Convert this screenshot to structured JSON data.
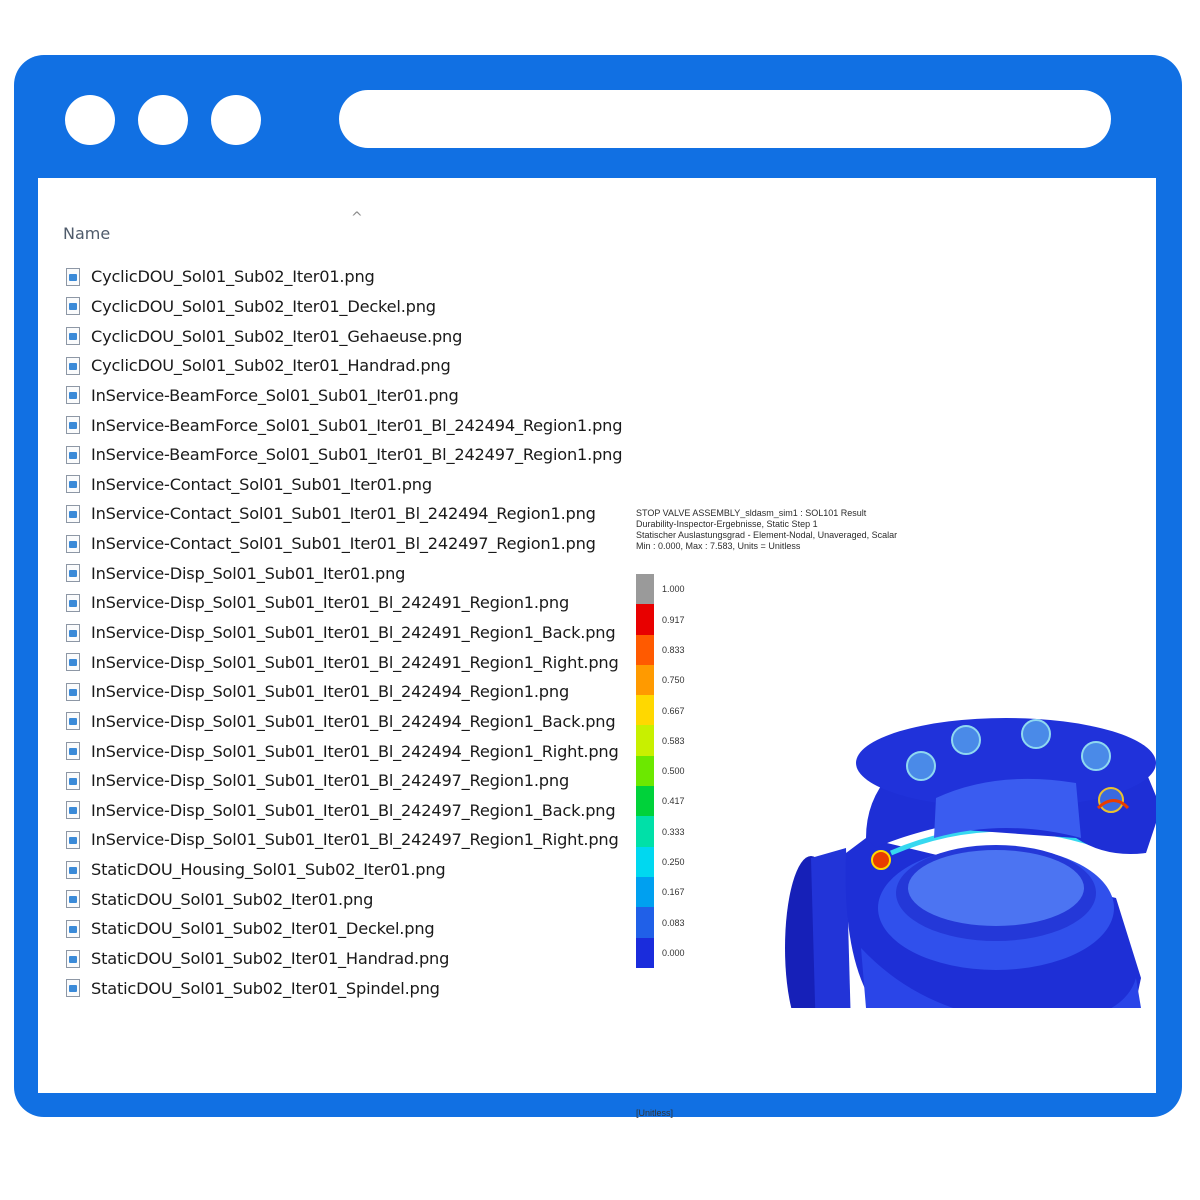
{
  "window": {
    "frame_color": "#1170e3",
    "controls": [
      "window-dot-1",
      "window-dot-2",
      "window-dot-3"
    ],
    "address": ""
  },
  "explorer": {
    "column_header": "Name",
    "sort_indicator": "^",
    "files": [
      "CyclicDOU_Sol01_Sub02_Iter01.png",
      "CyclicDOU_Sol01_Sub02_Iter01_Deckel.png",
      "CyclicDOU_Sol01_Sub02_Iter01_Gehaeuse.png",
      "CyclicDOU_Sol01_Sub02_Iter01_Handrad.png",
      "InService-BeamForce_Sol01_Sub01_Iter01.png",
      "InService-BeamForce_Sol01_Sub01_Iter01_Bl_242494_Region1.png",
      "InService-BeamForce_Sol01_Sub01_Iter01_Bl_242497_Region1.png",
      "InService-Contact_Sol01_Sub01_Iter01.png",
      "InService-Contact_Sol01_Sub01_Iter01_Bl_242494_Region1.png",
      "InService-Contact_Sol01_Sub01_Iter01_Bl_242497_Region1.png",
      "InService-Disp_Sol01_Sub01_Iter01.png",
      "InService-Disp_Sol01_Sub01_Iter01_Bl_242491_Region1.png",
      "InService-Disp_Sol01_Sub01_Iter01_Bl_242491_Region1_Back.png",
      "InService-Disp_Sol01_Sub01_Iter01_Bl_242491_Region1_Right.png",
      "InService-Disp_Sol01_Sub01_Iter01_Bl_242494_Region1.png",
      "InService-Disp_Sol01_Sub01_Iter01_Bl_242494_Region1_Back.png",
      "InService-Disp_Sol01_Sub01_Iter01_Bl_242494_Region1_Right.png",
      "InService-Disp_Sol01_Sub01_Iter01_Bl_242497_Region1.png",
      "InService-Disp_Sol01_Sub01_Iter01_Bl_242497_Region1_Back.png",
      "InService-Disp_Sol01_Sub01_Iter01_Bl_242497_Region1_Right.png",
      "StaticDOU_Housing_Sol01_Sub02_Iter01.png",
      "StaticDOU_Sol01_Sub02_Iter01.png",
      "StaticDOU_Sol01_Sub02_Iter01_Deckel.png",
      "StaticDOU_Sol01_Sub02_Iter01_Handrad.png",
      "StaticDOU_Sol01_Sub02_Iter01_Spindel.png"
    ]
  },
  "result_preview": {
    "header_lines": [
      "STOP VALVE ASSEMBLY_sldasm_sim1 : SOL101 Result",
      "Durability-Inspector-Ergebnisse, Static Step 1",
      "Statischer Auslastungsgrad - Element-Nodal, Unaveraged, Scalar",
      "Min : 0.000, Max : 7.583, Units = Unitless"
    ],
    "legend_values": [
      "1.000",
      "0.917",
      "0.833",
      "0.750",
      "0.667",
      "0.583",
      "0.500",
      "0.417",
      "0.333",
      "0.250",
      "0.167",
      "0.083",
      "0.000"
    ],
    "legend_colors": [
      "#9a9a9a",
      "#e80000",
      "#ff5a00",
      "#ff9a00",
      "#ffd800",
      "#c8f000",
      "#6ce800",
      "#00d23a",
      "#00e0a8",
      "#00d8f0",
      "#00a0f0",
      "#2060e8",
      "#1a2cdc"
    ],
    "units": "[Unitless]",
    "model_colors": {
      "body": "#1e2fd6",
      "dark": "#0d17a8",
      "light": "#3a5cf0",
      "hot": "#e83c00"
    }
  }
}
